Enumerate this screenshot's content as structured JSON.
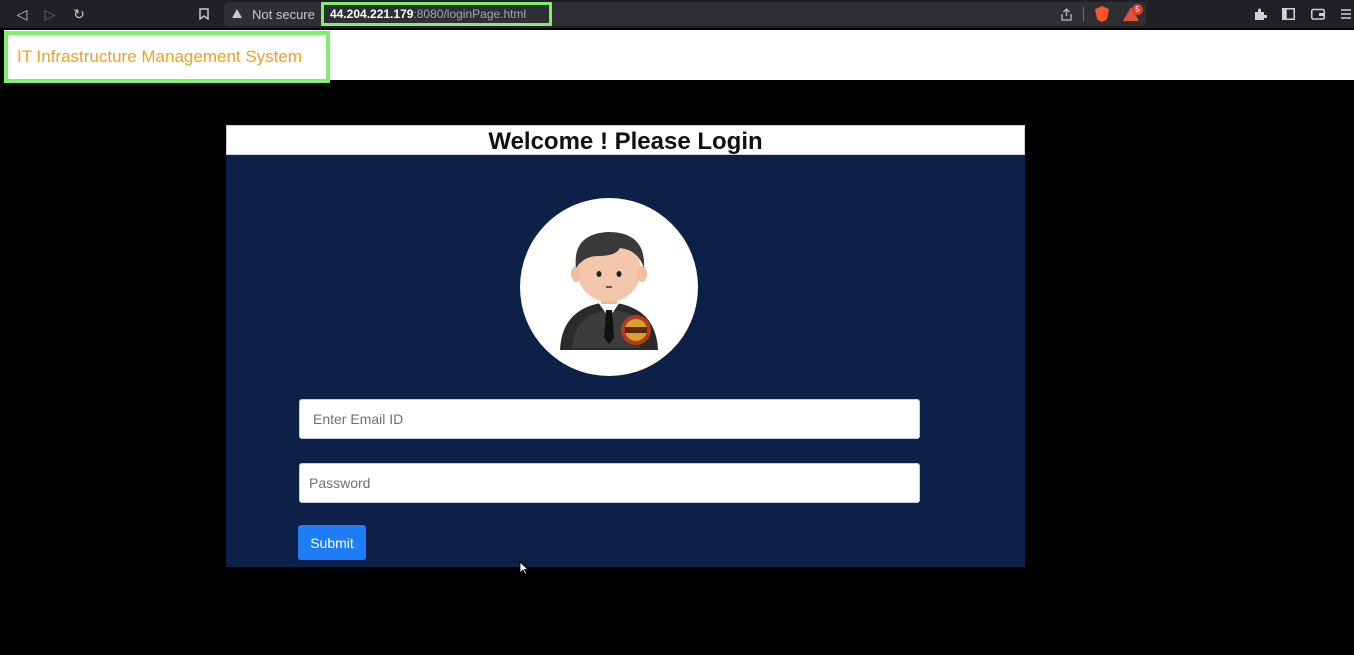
{
  "browser": {
    "security_label": "Not secure",
    "url_host": "44.204.221.179",
    "url_rest": ":8080/loginPage.html",
    "rewards_badge_count": "5"
  },
  "page": {
    "brand": "IT Infrastructure Management System",
    "login_card": {
      "title": "Welcome ! Please Login",
      "email_placeholder": "Enter Email ID",
      "password_placeholder": "Password",
      "submit_label": "Submit"
    }
  },
  "colors": {
    "highlight_border": "#7ef06e",
    "brand_text": "#f0a022",
    "card_background": "#0c2048",
    "submit_button": "#1e7cf5"
  }
}
